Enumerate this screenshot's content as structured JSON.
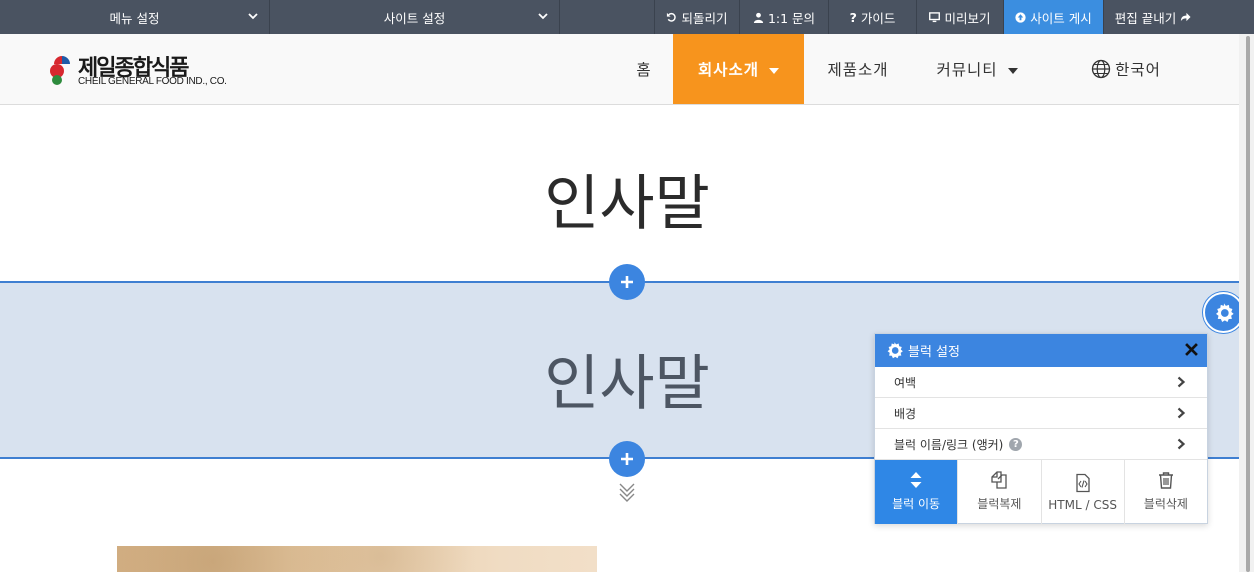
{
  "admin_bar": {
    "menu_settings": "메뉴 설정",
    "site_settings": "사이트 설정",
    "undo": "되돌리기",
    "inquiry": "1:1 문의",
    "guide": "가이드",
    "preview": "미리보기",
    "publish": "사이트 게시",
    "finish_edit": "편집 끝내기"
  },
  "header": {
    "logo_ko": "제일종합식품",
    "logo_en": "CHEIL GENERAL FOOD IND., CO.",
    "nav": {
      "home": "홈",
      "company": "회사소개",
      "products": "제품소개",
      "community": "커뮤니티",
      "language": "한국어"
    }
  },
  "content": {
    "title_top": "인사말",
    "title_selected": "인사말"
  },
  "block_panel": {
    "title": "블럭 설정",
    "rows": {
      "margin": "여백",
      "background": "배경",
      "name_link": "블럭 이름/링크 (앵커)"
    },
    "actions": {
      "move": "블럭 이동",
      "copy": "블럭복제",
      "html_css": "HTML / CSS",
      "delete": "블럭삭제"
    }
  },
  "colors": {
    "admin_bar": "#4a5361",
    "accent_blue": "#3c85e0",
    "nav_active": "#f7941d",
    "selected_block": "#d8e2ef"
  }
}
